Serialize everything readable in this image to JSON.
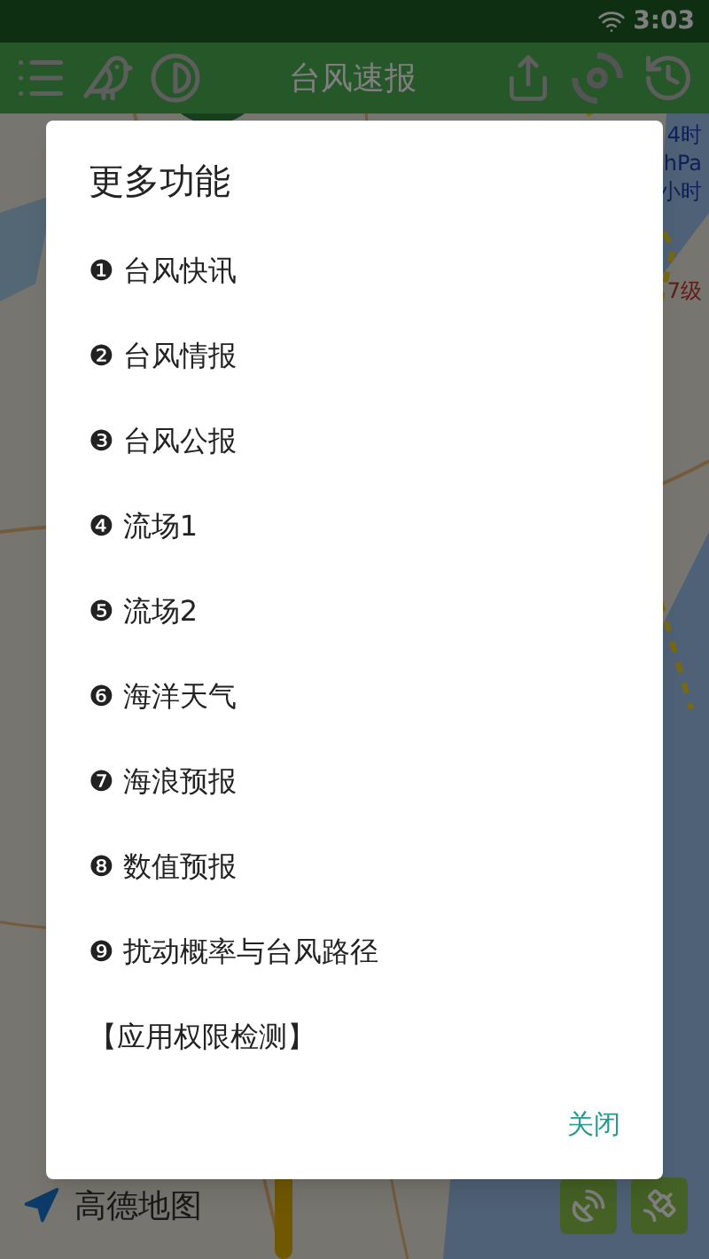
{
  "status_bar": {
    "time": "3:03"
  },
  "toolbar": {
    "title": "台风速报"
  },
  "map": {
    "legend": [
      "4时",
      "hPa",
      "小时",
      "7级"
    ],
    "attribution": "高德地图"
  },
  "dialog": {
    "title": "更多功能",
    "items": [
      {
        "label": "❶ 台风快讯"
      },
      {
        "label": "❷ 台风情报"
      },
      {
        "label": "❸ 台风公报"
      },
      {
        "label": "❹ 流场1"
      },
      {
        "label": "❺ 流场2"
      },
      {
        "label": "❻ 海洋天气"
      },
      {
        "label": "❼ 海浪预报"
      },
      {
        "label": "❽ 数值预报"
      },
      {
        "label": "❾ 扰动概率与台风路径"
      },
      {
        "label": "【应用权限检测】"
      }
    ],
    "button": "关闭"
  }
}
